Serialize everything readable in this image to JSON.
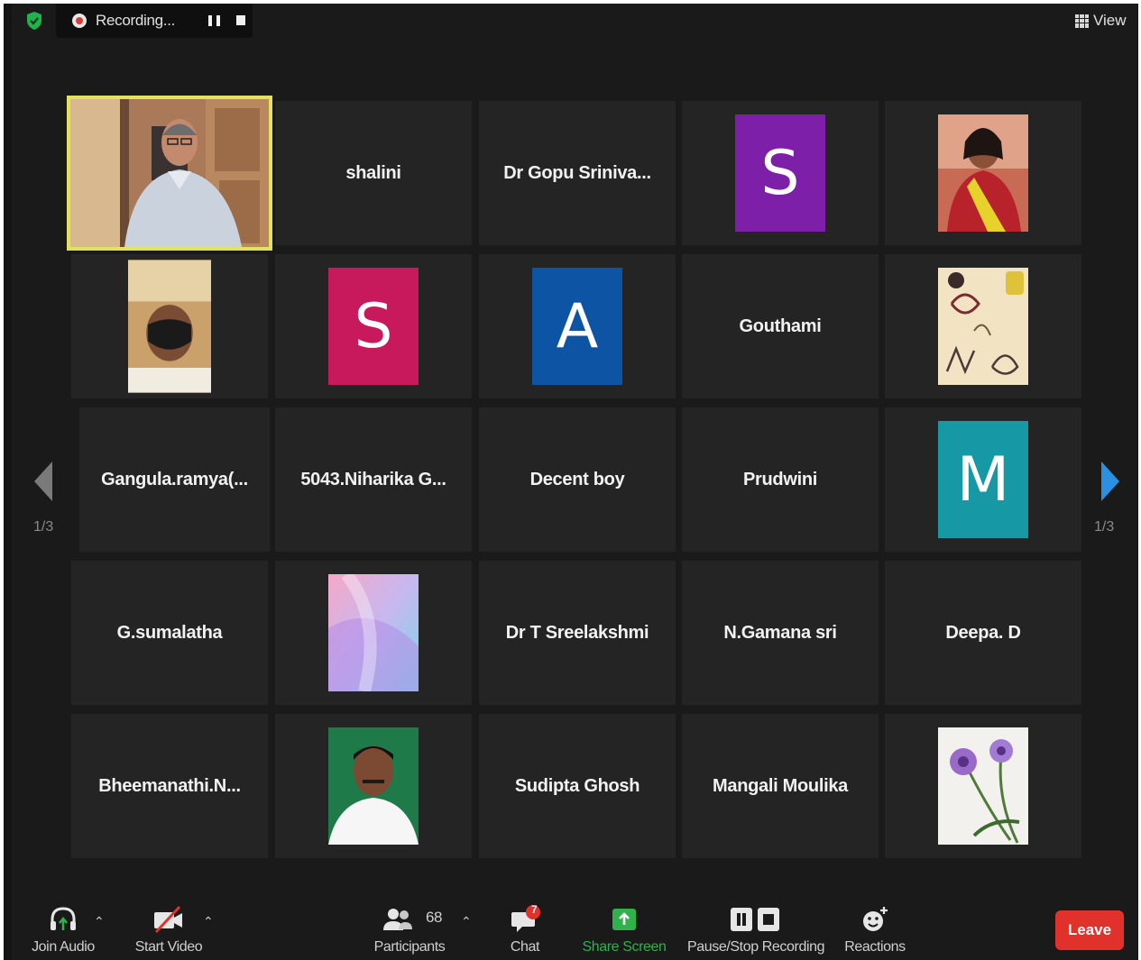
{
  "top_bar": {
    "recording_label": "Recording...",
    "view_label": "View"
  },
  "colors": {
    "active_speaker_border": "#e2e25e",
    "share_screen_green": "#2fb24a",
    "leave_red": "#e0312a",
    "nav_arrow_blue": "#2b90e0"
  },
  "pagination": {
    "left_indicator": "1/3",
    "right_indicator": "1/3"
  },
  "tiles": [
    {
      "kind": "video",
      "name": "",
      "icon": "man-in-office-photo"
    },
    {
      "kind": "name",
      "name": "shalini"
    },
    {
      "kind": "name",
      "name": "Dr  Gopu  Sriniva..."
    },
    {
      "kind": "avatar",
      "letter": "S",
      "color": "#7d1fa8"
    },
    {
      "kind": "photo",
      "name": "",
      "icon": "woman-in-saree-photo"
    },
    {
      "kind": "photo",
      "name": "",
      "icon": "person-with-mask-photo"
    },
    {
      "kind": "avatar",
      "letter": "S",
      "color": "#c8195c"
    },
    {
      "kind": "avatar",
      "letter": "A",
      "color": "#0e54a5"
    },
    {
      "kind": "name",
      "name": "Gouthami"
    },
    {
      "kind": "photo",
      "name": "",
      "icon": "queen-of-mom-dad-image"
    },
    {
      "kind": "name",
      "name": "Gangula.ramya(..."
    },
    {
      "kind": "name",
      "name": "5043.Niharika  G..."
    },
    {
      "kind": "name",
      "name": "Decent boy"
    },
    {
      "kind": "name",
      "name": "Prudwini"
    },
    {
      "kind": "avatar",
      "letter": "M",
      "color": "#1698a5"
    },
    {
      "kind": "name",
      "name": "G.sumalatha"
    },
    {
      "kind": "photo",
      "name": "",
      "icon": "pastel-abstract-image"
    },
    {
      "kind": "name",
      "name": "Dr T Sreelakshmi"
    },
    {
      "kind": "name",
      "name": "N.Gamana sri"
    },
    {
      "kind": "name",
      "name": "Deepa. D"
    },
    {
      "kind": "name",
      "name": "Bheemanathi.N..."
    },
    {
      "kind": "photo",
      "name": "",
      "icon": "man-portrait-photo"
    },
    {
      "kind": "name",
      "name": "Sudipta Ghosh"
    },
    {
      "kind": "name",
      "name": "Mangali Moulika"
    },
    {
      "kind": "photo",
      "name": "",
      "icon": "purple-flowers-photo"
    }
  ],
  "toolbar": {
    "join_audio": "Join Audio",
    "start_video": "Start Video",
    "participants": "Participants",
    "participants_count": "68",
    "chat": "Chat",
    "chat_badge": "7",
    "share_screen": "Share Screen",
    "pause_stop_recording": "Pause/Stop Recording",
    "reactions": "Reactions",
    "leave": "Leave"
  }
}
